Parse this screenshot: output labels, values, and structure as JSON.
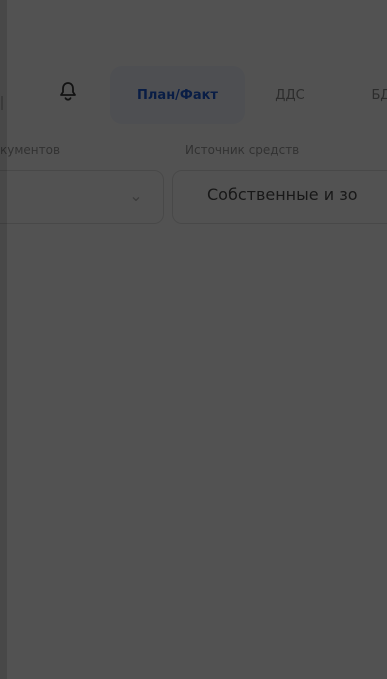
{
  "tabs": {
    "active": "План/Факт",
    "dds": "ДДС",
    "bd": "БД"
  },
  "filters": {
    "left_label": "кументов",
    "right_label": "Источник средств",
    "right_value": "Собственные и зо"
  },
  "icons": {
    "bell": "bell-icon",
    "chevron": "chevron-down-icon"
  },
  "colors": {
    "background": "#ffffff",
    "overlay": "#4a4a4a",
    "active_tab_bg": "#f1f5ff",
    "active_tab_text": "#1d5bd6",
    "muted_text": "#9a9a9a"
  }
}
